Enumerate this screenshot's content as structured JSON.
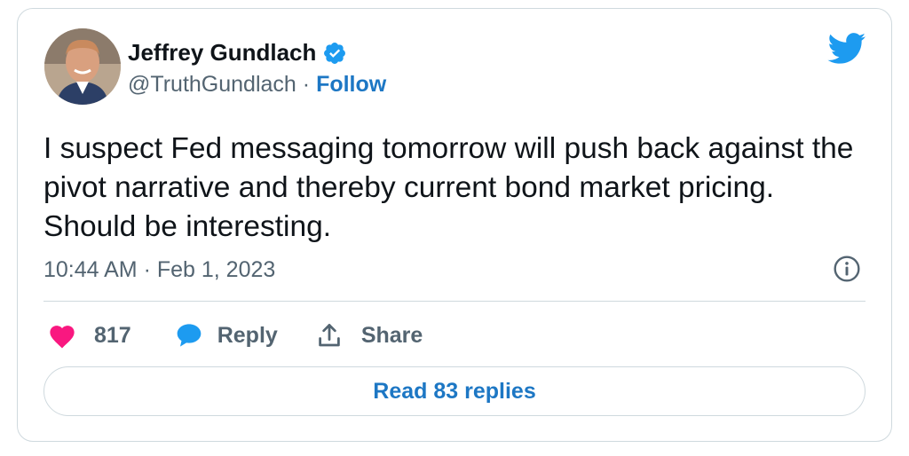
{
  "author": {
    "display_name": "Jeffrey Gundlach",
    "handle": "@TruthGundlach",
    "separator": "·",
    "follow_label": "Follow",
    "verified": true,
    "avatar_icon": "person-avatar"
  },
  "tweet": {
    "text": "I suspect Fed messaging tomorrow will push back against the pivot narrative and thereby current bond market pricing.  Should be interesting.",
    "timestamp": "10:44 AM · Feb 1, 2023"
  },
  "actions": {
    "like_count": "817",
    "reply_label": "Reply",
    "share_label": "Share"
  },
  "footer": {
    "read_replies_label": "Read 83 replies"
  },
  "icons": {
    "brand": "twitter-bird-icon",
    "verified": "verified-badge-icon",
    "info": "info-icon",
    "like": "heart-icon",
    "reply": "speech-bubble-icon",
    "share": "share-icon"
  },
  "colors": {
    "accent": "#1d77c4",
    "twitter_blue": "#1d9bf0",
    "like_pink": "#f91880",
    "muted_text": "#536471",
    "border": "#cfd9de",
    "text": "#0f1419"
  }
}
